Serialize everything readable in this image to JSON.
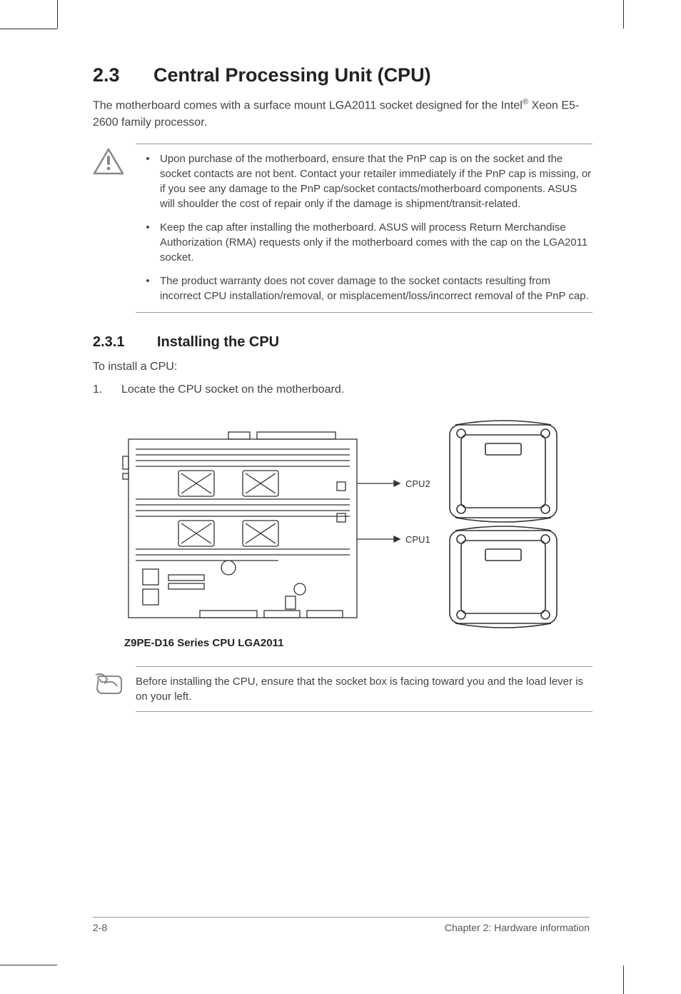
{
  "heading": {
    "number": "2.3",
    "title": "Central Processing Unit (CPU)"
  },
  "intro": {
    "pre": "The motherboard comes with a surface mount LGA2011 socket designed for the Intel",
    "sup": "®",
    "post": " Xeon E5-2600 family processor."
  },
  "caution_items": [
    "Upon purchase of the motherboard, ensure that the PnP cap is on the socket and the socket contacts are not bent. Contact your retailer immediately if the PnP cap is missing, or if you see any damage to the PnP cap/socket contacts/motherboard components. ASUS will shoulder the cost of repair only if the damage is shipment/transit-related.",
    "Keep the cap after installing the motherboard. ASUS will process Return Merchandise Authorization (RMA) requests only if the motherboard comes with the cap on the LGA2011 socket.",
    "The product warranty does not cover damage to the socket contacts resulting from incorrect CPU installation/removal, or misplacement/loss/incorrect removal of the PnP cap."
  ],
  "subheading": {
    "number": "2.3.1",
    "title": "Installing the CPU"
  },
  "lead": "To install a CPU:",
  "step1": {
    "n": "1.",
    "text": "Locate the CPU socket on the motherboard."
  },
  "diagram": {
    "cpu2": "CPU2",
    "cpu1": "CPU1",
    "caption": "Z9PE-D16 Series CPU LGA2011"
  },
  "tip": "Before installing the CPU, ensure that the socket box is facing toward you and the load lever is on your left.",
  "footer": {
    "page": "2-8",
    "chapter": "Chapter 2: Hardware information"
  }
}
